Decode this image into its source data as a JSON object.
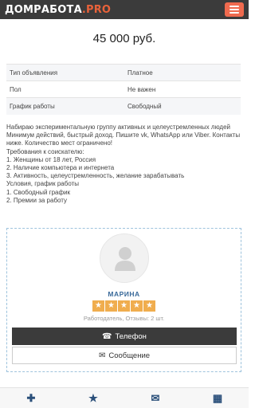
{
  "header": {
    "logo_main": "ДОМРАБОТА",
    "logo_suffix": ".PRO",
    "menu_icon": "hamburger-icon",
    "accent_color": "#ef6a4e"
  },
  "listing": {
    "price": "45 000 руб.",
    "details": [
      {
        "key": "Тип объявления",
        "value": "Платное"
      },
      {
        "key": "Пол",
        "value": "Не важен"
      },
      {
        "key": "График работы",
        "value": "Свободный"
      }
    ],
    "description_lines": [
      "Набираю экспериментальную группу активных и целеустремленных людей",
      "Минимум действий, быстрый доход. Пишите vk, WhatsApp или Viber. Контакты ниже. Количество мест ограничено!",
      "Требования к соискателю:",
      "1. Женщины от 18 лет, Россия",
      "2. Наличие компьютера и интернета",
      "3. Активность, целеустремленность, желание зарабатывать",
      "Условия, график работы",
      "1. Свободный график",
      "2. Премии за работу"
    ]
  },
  "seller": {
    "avatar_icon": "user-silhouette-icon",
    "name": "МАРИНА",
    "rating": 5,
    "star_color": "#f0ad4e",
    "meta": "Работодатель, Отзывы: 2 шт.",
    "phone_label": "Телефон",
    "phone_icon": "phone-icon",
    "message_label": "Сообщение",
    "message_icon": "envelope-icon"
  },
  "bottom_nav": {
    "items": [
      {
        "icon": "plus-icon",
        "glyph": "✚"
      },
      {
        "icon": "star-icon",
        "glyph": "★"
      },
      {
        "icon": "envelope-icon",
        "glyph": "✉"
      },
      {
        "icon": "grid-icon",
        "glyph": "▦"
      }
    ],
    "icon_color": "#2a4f7a"
  }
}
